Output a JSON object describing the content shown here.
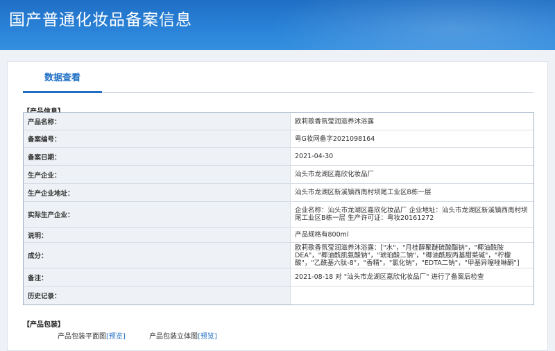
{
  "header": {
    "title": "国产普通化妆品备案信息"
  },
  "tab": {
    "label": "数据查看"
  },
  "sections": {
    "info": "【产品信息】",
    "packaging": "【产品包装】"
  },
  "info_rows": [
    {
      "label": "产品名称：",
      "value": "欧莉歌香氛莹润滋养沐浴露"
    },
    {
      "label": "备案编号：",
      "value": "粤G妆网备字2021098164"
    },
    {
      "label": "备案日期：",
      "value": "2021-04-30"
    },
    {
      "label": "生产企业：",
      "value": "汕头市龙湖区嘉欣化妆品厂"
    },
    {
      "label": "生产企业地址：",
      "value": "汕头市龙湖区新溪镇西南村坝尾工业区B栋一层"
    },
    {
      "label": "实际生产企业：",
      "value": "企业名称：汕头市龙湖区嘉欣化妆品厂 企业地址：汕头市龙湖区新溪镇西南村坝尾工业区B栋一层 生产许可证：粤妆20161272"
    },
    {
      "label": "说明：",
      "value": "产品规格有800ml"
    },
    {
      "label": "成分：",
      "value": "欧莉歌香氛莹润滋养沐浴露：[\"水\"，\"月桂醇聚醚硫酸酯钠\"，\"椰油酰胺DEA\"，\"椰油酰肌氨酸钠\"，\"琥珀酸二钠\"，\"椰油酰胺丙基甜菜碱\"，\"柠檬酸\"，\"乙酰基六肽-8\"，\"香精\"，\"氯化钠\"，\"EDTA二钠\"，\"甲基异噻唑啉酮\"]"
    },
    {
      "label": "备注：",
      "value": "2021-08-18 对 \"汕头市龙湖区嘉欣化妆品厂\" 进行了备案后检查"
    },
    {
      "label": "历史记录：",
      "value": ""
    }
  ],
  "packaging": {
    "flat_label": "产品包装平面图",
    "stereo_label": "产品包装立体图",
    "preview_text": "[预览]"
  }
}
